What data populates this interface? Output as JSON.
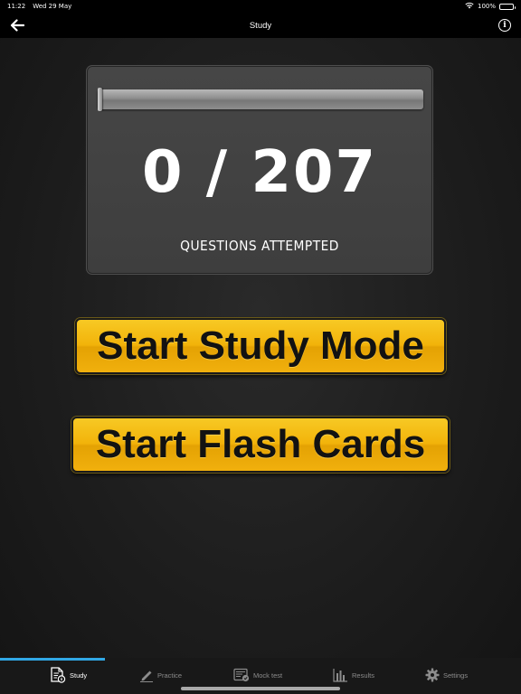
{
  "status_bar": {
    "time": "11:22",
    "date": "Wed 29 May",
    "battery": "100%"
  },
  "nav": {
    "title": "Study"
  },
  "progress": {
    "attempted": 0,
    "total": 207,
    "count_text": "0 / 207",
    "label": "QUESTIONS ATTEMPTED",
    "fraction": 0
  },
  "buttons": {
    "study_mode": "Start Study Mode",
    "flash_cards": "Start Flash Cards"
  },
  "tabs": [
    {
      "label": "Study",
      "icon": "study-document-icon",
      "active": true
    },
    {
      "label": "Practice",
      "icon": "pencil-icon",
      "active": false
    },
    {
      "label": "Mock test",
      "icon": "mock-test-icon",
      "active": false
    },
    {
      "label": "Results",
      "icon": "bar-chart-icon",
      "active": false
    },
    {
      "label": "Settings",
      "icon": "gear-icon",
      "active": false
    }
  ],
  "colors": {
    "accent": "#31a8e6",
    "button_yellow": "#f2b30a",
    "background": "#1c1c1c",
    "panel": "#434343"
  }
}
